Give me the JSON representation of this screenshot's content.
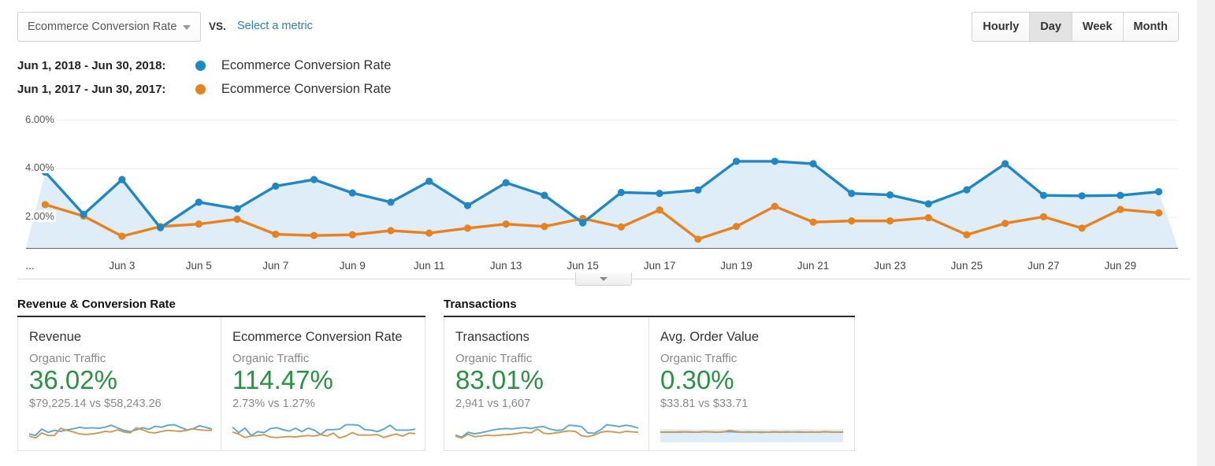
{
  "toolbar": {
    "metric_select_value": "Ecommerce Conversion Rate",
    "vs_label": "VS.",
    "select_metric_link": "Select a metric",
    "granularity": [
      {
        "label": "Hourly",
        "active": false
      },
      {
        "label": "Day",
        "active": true
      },
      {
        "label": "Week",
        "active": false
      },
      {
        "label": "Month",
        "active": false
      }
    ]
  },
  "legend": {
    "rows": [
      {
        "date_range": "Jun 1, 2018 - Jun 30, 2018:",
        "metric": "Ecommerce Conversion Rate",
        "color": "#1f87c4"
      },
      {
        "date_range": "Jun 1, 2017 - Jun 30, 2017:",
        "metric": "Ecommerce Conversion Rate",
        "color": "#e8821e"
      }
    ]
  },
  "chart_footer": {
    "collapse_icon": "chevron-down-icon"
  },
  "chart_data": {
    "type": "line",
    "title": "Ecommerce Conversion Rate",
    "xlabel": "",
    "ylabel": "Ecommerce Conversion Rate",
    "ylim": [
      0,
      6
    ],
    "ytick_labels": [
      "6.00%",
      "4.00%",
      "2.00%"
    ],
    "ytick_values": [
      6,
      4,
      2
    ],
    "grid": true,
    "legend_position": "top-left",
    "x_axis_leading_label": "...",
    "x_tick_labels": [
      "Jun 3",
      "Jun 5",
      "Jun 7",
      "Jun 9",
      "Jun 11",
      "Jun 13",
      "Jun 15",
      "Jun 17",
      "Jun 19",
      "Jun 21",
      "Jun 23",
      "Jun 25",
      "Jun 27",
      "Jun 29"
    ],
    "x": [
      "Jun 1",
      "Jun 2",
      "Jun 3",
      "Jun 4",
      "Jun 5",
      "Jun 6",
      "Jun 7",
      "Jun 8",
      "Jun 9",
      "Jun 10",
      "Jun 11",
      "Jun 12",
      "Jun 13",
      "Jun 14",
      "Jun 15",
      "Jun 16",
      "Jun 17",
      "Jun 18",
      "Jun 19",
      "Jun 20",
      "Jun 21",
      "Jun 22",
      "Jun 23",
      "Jun 24",
      "Jun 25",
      "Jun 26",
      "Jun 27",
      "Jun 28",
      "Jun 29",
      "Jun 30"
    ],
    "series": [
      {
        "name": "Ecommerce Conversion Rate",
        "date_range": "Jun 1, 2018 - Jun 30, 2018",
        "color": "#1f87c4",
        "values": [
          3.86,
          2.12,
          3.55,
          1.57,
          2.62,
          2.35,
          3.28,
          3.55,
          3.0,
          2.62,
          3.48,
          2.48,
          3.42,
          2.9,
          1.77,
          3.02,
          2.98,
          3.12,
          4.3,
          4.3,
          4.2,
          2.98,
          2.92,
          2.55,
          3.13,
          4.2,
          2.9,
          2.88,
          2.9,
          3.05
        ]
      },
      {
        "name": "Ecommerce Conversion Rate",
        "date_range": "Jun 1, 2017 - Jun 30, 2017",
        "color": "#e8821e",
        "values": [
          2.52,
          2.05,
          1.22,
          1.62,
          1.72,
          1.92,
          1.3,
          1.25,
          1.28,
          1.45,
          1.35,
          1.55,
          1.72,
          1.62,
          1.95,
          1.6,
          2.3,
          1.1,
          1.62,
          2.45,
          1.8,
          1.85,
          1.85,
          1.98,
          1.28,
          1.75,
          2.02,
          1.55,
          2.32,
          2.18
        ]
      }
    ]
  },
  "sections": [
    {
      "title": "Revenue & Conversion Rate",
      "cards": [
        {
          "title": "Revenue",
          "segment": "Organic Traffic",
          "value": "36.02%",
          "value_color": "#2a9142",
          "compare": "$79,225.14 vs $58,243.26",
          "sparkline": {
            "type": "line",
            "series": [
              {
                "name": "current",
                "color": "#5ba7d1",
                "values": [
                  0.36,
                  0.3,
                  0.55,
                  0.42,
                  0.5,
                  0.46,
                  0.52,
                  0.56,
                  0.62,
                  0.58,
                  0.6,
                  0.58,
                  0.62,
                  0.7,
                  0.6,
                  0.5,
                  0.45,
                  0.52,
                  0.6,
                  0.54,
                  0.66,
                  0.62,
                  0.7,
                  0.72,
                  0.62,
                  0.52,
                  0.56,
                  0.68,
                  0.62,
                  0.55
                ]
              },
              {
                "name": "previous",
                "color": "#c99a5a",
                "values": [
                  0.28,
                  0.2,
                  0.4,
                  0.3,
                  0.3,
                  0.58,
                  0.5,
                  0.44,
                  0.36,
                  0.34,
                  0.36,
                  0.4,
                  0.46,
                  0.44,
                  0.52,
                  0.44,
                  0.4,
                  0.6,
                  0.52,
                  0.42,
                  0.4,
                  0.46,
                  0.5,
                  0.48,
                  0.46,
                  0.5,
                  0.56,
                  0.52,
                  0.5,
                  0.5
                ]
              }
            ]
          }
        },
        {
          "title": "Ecommerce Conversion Rate",
          "segment": "Organic Traffic",
          "value": "114.47%",
          "value_color": "#2a9142",
          "compare": "2.73% vs 1.27%",
          "sparkline": {
            "type": "line",
            "series": [
              {
                "name": "current",
                "color": "#5ba7d1",
                "values": [
                  0.62,
                  0.4,
                  0.58,
                  0.28,
                  0.44,
                  0.4,
                  0.56,
                  0.6,
                  0.52,
                  0.46,
                  0.58,
                  0.44,
                  0.58,
                  0.5,
                  0.32,
                  0.52,
                  0.52,
                  0.54,
                  0.72,
                  0.72,
                  0.7,
                  0.52,
                  0.5,
                  0.44,
                  0.54,
                  0.7,
                  0.5,
                  0.5,
                  0.5,
                  0.54
                ]
              },
              {
                "name": "previous",
                "color": "#c99a5a",
                "values": [
                  0.42,
                  0.34,
                  0.2,
                  0.26,
                  0.28,
                  0.32,
                  0.22,
                  0.2,
                  0.22,
                  0.24,
                  0.22,
                  0.26,
                  0.28,
                  0.26,
                  0.32,
                  0.26,
                  0.38,
                  0.18,
                  0.26,
                  0.4,
                  0.3,
                  0.3,
                  0.3,
                  0.32,
                  0.2,
                  0.28,
                  0.34,
                  0.26,
                  0.38,
                  0.36
                ]
              }
            ]
          }
        }
      ]
    },
    {
      "title": "Transactions",
      "cards": [
        {
          "title": "Transactions",
          "segment": "Organic Traffic",
          "value": "83.01%",
          "value_color": "#2a9142",
          "compare": "2,941 vs 1,607",
          "sparkline": {
            "type": "line",
            "series": [
              {
                "name": "current",
                "color": "#5ba7d1",
                "values": [
                  0.3,
                  0.22,
                  0.42,
                  0.36,
                  0.4,
                  0.46,
                  0.52,
                  0.56,
                  0.58,
                  0.56,
                  0.6,
                  0.62,
                  0.58,
                  0.64,
                  0.66,
                  0.56,
                  0.5,
                  0.52,
                  0.72,
                  0.7,
                  0.66,
                  0.4,
                  0.38,
                  0.52,
                  0.74,
                  0.7,
                  0.66,
                  0.72,
                  0.68,
                  0.6
                ]
              },
              {
                "name": "previous",
                "color": "#c99a5a",
                "values": [
                  0.26,
                  0.18,
                  0.34,
                  0.24,
                  0.26,
                  0.3,
                  0.28,
                  0.3,
                  0.32,
                  0.34,
                  0.38,
                  0.42,
                  0.4,
                  0.56,
                  0.38,
                  0.36,
                  0.4,
                  0.44,
                  0.48,
                  0.46,
                  0.28,
                  0.24,
                  0.3,
                  0.42,
                  0.46,
                  0.44,
                  0.4,
                  0.46,
                  0.44,
                  0.42
                ]
              }
            ]
          }
        },
        {
          "title": "Avg. Order Value",
          "segment": "Organic Traffic",
          "value": "0.30%",
          "value_color": "#2a9142",
          "compare": "$33.81 vs $33.71",
          "sparkline": {
            "type": "line",
            "series": [
              {
                "name": "current",
                "color": "#5ba7d1",
                "values": [
                  0.5,
                  0.5,
                  0.51,
                  0.5,
                  0.52,
                  0.51,
                  0.5,
                  0.52,
                  0.51,
                  0.5,
                  0.52,
                  0.53,
                  0.51,
                  0.5,
                  0.52,
                  0.5,
                  0.49,
                  0.5,
                  0.51,
                  0.5,
                  0.52,
                  0.51,
                  0.5,
                  0.5,
                  0.51,
                  0.5,
                  0.52,
                  0.51,
                  0.5,
                  0.51
                ]
              },
              {
                "name": "previous",
                "color": "#c99a5a",
                "values": [
                  0.5,
                  0.51,
                  0.5,
                  0.52,
                  0.51,
                  0.5,
                  0.51,
                  0.53,
                  0.52,
                  0.5,
                  0.51,
                  0.6,
                  0.54,
                  0.5,
                  0.49,
                  0.5,
                  0.51,
                  0.5,
                  0.52,
                  0.51,
                  0.5,
                  0.51,
                  0.52,
                  0.5,
                  0.51,
                  0.5,
                  0.52,
                  0.51,
                  0.5,
                  0.5
                ]
              }
            ]
          }
        }
      ]
    }
  ]
}
